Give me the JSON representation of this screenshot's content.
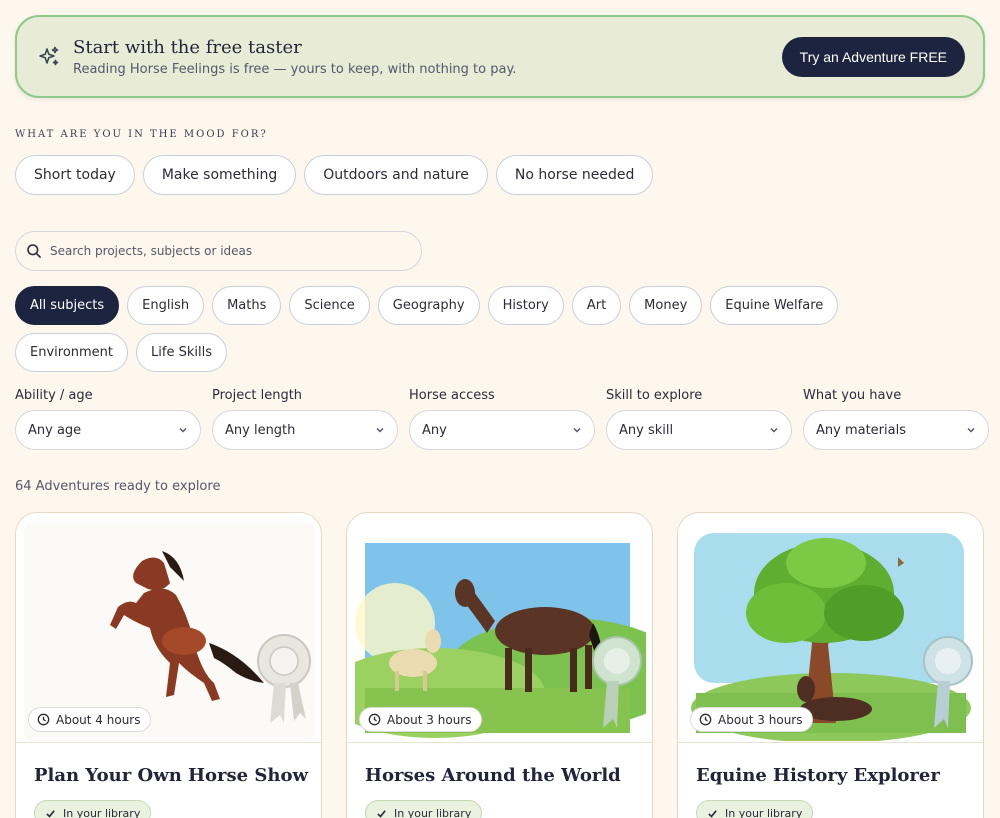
{
  "banner": {
    "title": "Start with the free taster",
    "subtitle": "Reading Horse Feelings is free — yours to keep, with nothing to pay.",
    "button": "Try an Adventure FREE",
    "icon": "sparkle-icon"
  },
  "mood": {
    "label": "What are you in the mood for?",
    "options": [
      "Short today",
      "Make something",
      "Outdoors and nature",
      "No horse needed"
    ]
  },
  "search": {
    "placeholder": "Search projects, subjects or ideas",
    "value": ""
  },
  "subjects": {
    "selected": "All subjects",
    "items": [
      "All subjects",
      "English",
      "Maths",
      "Science",
      "Geography",
      "History",
      "Art",
      "Money",
      "Equine Welfare",
      "Environment",
      "Life Skills"
    ]
  },
  "filters": [
    {
      "label": "Ability / age",
      "value": "Any age"
    },
    {
      "label": "Project length",
      "value": "Any length"
    },
    {
      "label": "Horse access",
      "value": "Any"
    },
    {
      "label": "Skill to explore",
      "value": "Any skill"
    },
    {
      "label": "What you have",
      "value": "Any materials"
    }
  ],
  "count_text": "64 Adventures ready to explore",
  "cards": [
    {
      "title": "Plan Your Own Horse Show",
      "duration": "About 4 hours",
      "status": "In your library"
    },
    {
      "title": "Horses Around the World",
      "duration": "About 3 hours",
      "status": "In your library"
    },
    {
      "title": "Equine History Explorer",
      "duration": "About 3 hours",
      "status": "In your library"
    }
  ],
  "colors": {
    "primary": "#1d2440",
    "banner_bg": "#e8ecd6",
    "banner_border": "#8fc98a",
    "page_bg": "#fdf7ee",
    "library_bg": "#e9f1df"
  }
}
